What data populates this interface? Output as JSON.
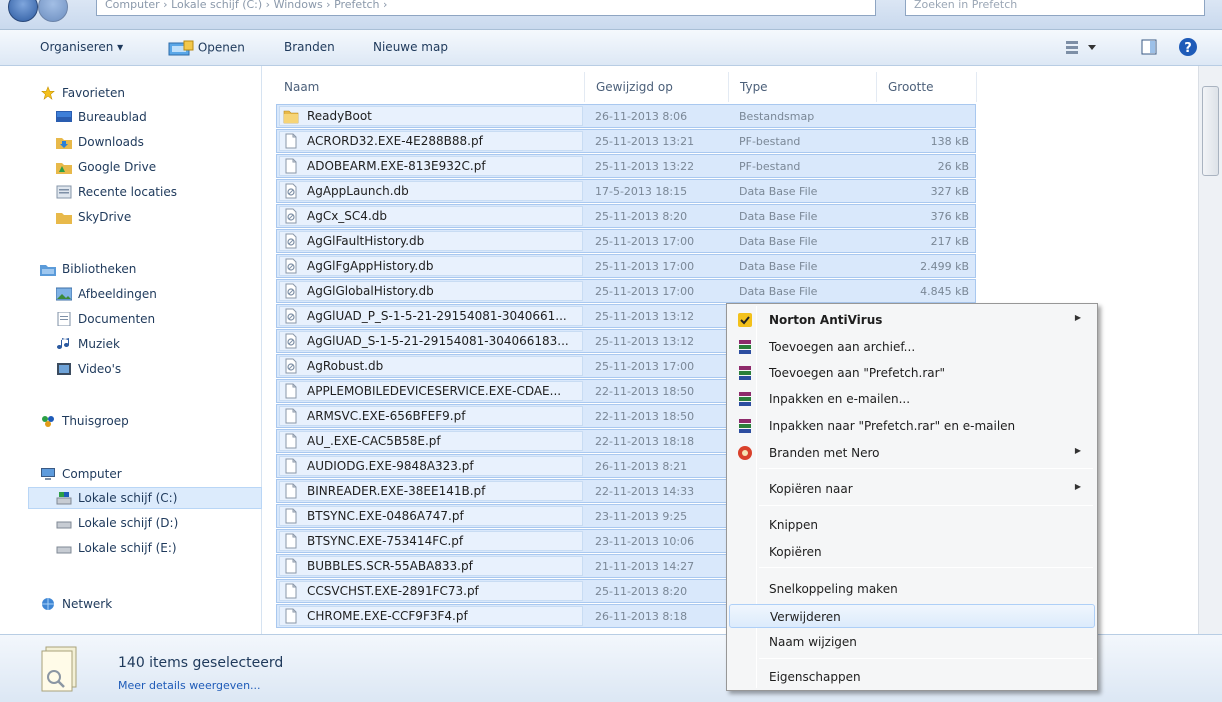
{
  "address": {
    "path": "Computer  ›  Lokale schijf (C:)  ›  Windows  ›  Prefetch  ›",
    "search_placeholder": "Zoeken in Prefetch"
  },
  "toolbar": {
    "organize": "Organiseren ▾",
    "open": "Openen",
    "burn": "Branden",
    "new_folder": "Nieuwe map"
  },
  "nav": {
    "favorites": "Favorieten",
    "desktop": "Bureaublad",
    "downloads": "Downloads",
    "google_drive": "Google Drive",
    "recent": "Recente locaties",
    "skydrive": "SkyDrive",
    "libraries": "Bibliotheken",
    "pictures": "Afbeeldingen",
    "documents": "Documenten",
    "music": "Muziek",
    "videos": "Video's",
    "homegroup": "Thuisgroep",
    "computer": "Computer",
    "drive_c": "Lokale schijf (C:)",
    "drive_d": "Lokale schijf (D:)",
    "drive_e": "Lokale schijf (E:)",
    "network": "Netwerk"
  },
  "columns": {
    "name": "Naam",
    "modified": "Gewijzigd op",
    "type": "Type",
    "size": "Grootte"
  },
  "files": [
    {
      "name": "ReadyBoot",
      "date": "26-11-2013 8:06",
      "type": "Bestandsmap",
      "size": "",
      "icon": "folder-icon"
    },
    {
      "name": "ACRORD32.EXE-4E288B88.pf",
      "date": "25-11-2013 13:21",
      "type": "PF-bestand",
      "size": "138 kB",
      "icon": "file-icon"
    },
    {
      "name": "ADOBEARM.EXE-813E932C.pf",
      "date": "25-11-2013 13:22",
      "type": "PF-bestand",
      "size": "26 kB",
      "icon": "file-icon"
    },
    {
      "name": "AgAppLaunch.db",
      "date": "17-5-2013 18:15",
      "type": "Data Base File",
      "size": "327 kB",
      "icon": "db-icon"
    },
    {
      "name": "AgCx_SC4.db",
      "date": "25-11-2013 8:20",
      "type": "Data Base File",
      "size": "376 kB",
      "icon": "db-icon"
    },
    {
      "name": "AgGlFaultHistory.db",
      "date": "25-11-2013 17:00",
      "type": "Data Base File",
      "size": "217 kB",
      "icon": "db-icon"
    },
    {
      "name": "AgGlFgAppHistory.db",
      "date": "25-11-2013 17:00",
      "type": "Data Base File",
      "size": "2.499 kB",
      "icon": "db-icon"
    },
    {
      "name": "AgGlGlobalHistory.db",
      "date": "25-11-2013 17:00",
      "type": "Data Base File",
      "size": "4.845 kB",
      "icon": "db-icon"
    },
    {
      "name": "AgGlUAD_P_S-1-5-21-29154081-3040661...",
      "date": "25-11-2013 13:12",
      "type": "",
      "size": "",
      "icon": "db-icon"
    },
    {
      "name": "AgGlUAD_S-1-5-21-29154081-304066183...",
      "date": "25-11-2013 13:12",
      "type": "",
      "size": "",
      "icon": "db-icon"
    },
    {
      "name": "AgRobust.db",
      "date": "25-11-2013 17:00",
      "type": "",
      "size": "",
      "icon": "db-icon"
    },
    {
      "name": "APPLEMOBILEDEVICESERVICE.EXE-CDAE...",
      "date": "22-11-2013 18:50",
      "type": "",
      "size": "",
      "icon": "file-icon"
    },
    {
      "name": "ARMSVC.EXE-656BFEF9.pf",
      "date": "22-11-2013 18:50",
      "type": "",
      "size": "",
      "icon": "file-icon"
    },
    {
      "name": "AU_.EXE-CAC5B58E.pf",
      "date": "22-11-2013 18:18",
      "type": "",
      "size": "",
      "icon": "file-icon"
    },
    {
      "name": "AUDIODG.EXE-9848A323.pf",
      "date": "26-11-2013 8:21",
      "type": "",
      "size": "",
      "icon": "file-icon"
    },
    {
      "name": "BINREADER.EXE-38EE141B.pf",
      "date": "22-11-2013 14:33",
      "type": "",
      "size": "",
      "icon": "file-icon"
    },
    {
      "name": "BTSYNC.EXE-0486A747.pf",
      "date": "23-11-2013 9:25",
      "type": "",
      "size": "",
      "icon": "file-icon"
    },
    {
      "name": "BTSYNC.EXE-753414FC.pf",
      "date": "23-11-2013 10:06",
      "type": "",
      "size": "",
      "icon": "file-icon"
    },
    {
      "name": "BUBBLES.SCR-55ABA833.pf",
      "date": "21-11-2013 14:27",
      "type": "",
      "size": "",
      "icon": "file-icon"
    },
    {
      "name": "CCSVCHST.EXE-2891FC73.pf",
      "date": "25-11-2013 8:20",
      "type": "",
      "size": "",
      "icon": "file-icon"
    },
    {
      "name": "CHROME.EXE-CCF9F3F4.pf",
      "date": "26-11-2013 8:18",
      "type": "",
      "size": "",
      "icon": "file-icon"
    }
  ],
  "context_menu": {
    "norton": "Norton AntiVirus",
    "add_archive": "Toevoegen aan archief...",
    "add_rar": "Toevoegen aan \"Prefetch.rar\"",
    "compress_email": "Inpakken en e-mailen...",
    "compress_rar_email": "Inpakken naar \"Prefetch.rar\" en e-mailen",
    "burn_nero": "Branden met Nero",
    "copy_to": "Kopiëren naar",
    "cut": "Knippen",
    "copy": "Kopiëren",
    "create_shortcut": "Snelkoppeling maken",
    "delete": "Verwijderen",
    "rename": "Naam wijzigen",
    "properties": "Eigenschappen"
  },
  "status": {
    "count": "140 items geselecteerd",
    "details": "Meer details weergeven..."
  },
  "colors": {
    "selection": "#d9e8fb",
    "selection_border": "#a9c8ef",
    "toolbar": "#dde8f5",
    "menu_hover": "#dcebfc"
  }
}
